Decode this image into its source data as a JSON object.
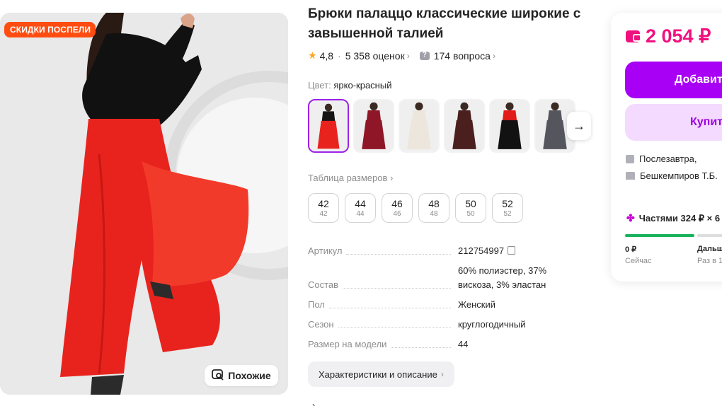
{
  "product": {
    "title": "Брюки палаццо классические широкие с завышенной талией",
    "rating": "4,8",
    "reviews": "5 358 оценок",
    "questions": "174 вопроса",
    "sale_badge": "СКИДКИ ПОСПЕЛИ",
    "similar_label": "Похожие"
  },
  "color": {
    "label": "Цвет:",
    "value": "ярко-красный",
    "swatches": [
      {
        "name": "ярко-красный",
        "main": "#e8231e",
        "top": "#151515"
      },
      {
        "name": "бордовый",
        "main": "#8f1626",
        "top": "#8f1626"
      },
      {
        "name": "молочный",
        "main": "#ece6dd",
        "top": "#ece6dd"
      },
      {
        "name": "шоколадный",
        "main": "#4a1f1d",
        "top": "#4a1f1d"
      },
      {
        "name": "черный",
        "main": "#121212",
        "top": "#e21a1a"
      },
      {
        "name": "серый",
        "main": "#55555d",
        "top": "#55555d"
      }
    ]
  },
  "sizes": {
    "table_link": "Таблица размеров",
    "items": [
      {
        "ru": "42",
        "intl": "42"
      },
      {
        "ru": "44",
        "intl": "44"
      },
      {
        "ru": "46",
        "intl": "46"
      },
      {
        "ru": "48",
        "intl": "48"
      },
      {
        "ru": "50",
        "intl": "50"
      },
      {
        "ru": "52",
        "intl": "52"
      }
    ]
  },
  "specs": [
    {
      "key": "Артикул",
      "value": "212754997"
    },
    {
      "key": "Состав",
      "value": "60% полиэстер, 37% вискоза, 3% эластан"
    },
    {
      "key": "Пол",
      "value": "Женский"
    },
    {
      "key": "Сезон",
      "value": "круглогодичный"
    },
    {
      "key": "Размер на модели",
      "value": "44"
    }
  ],
  "chars_button": "Характеристики и описание",
  "buy": {
    "price": "2 054 ₽",
    "add_label": "Добавит",
    "buy_label": "Купит",
    "delivery": "Послезавтра,",
    "seller": "Бешкемпиров Т.Б.",
    "parts": "Частями 324 ₽ × 6",
    "pay_now_amount": "0 ₽",
    "pay_now_label": "Сейчас",
    "pay_later_amount": "Дальш",
    "pay_later_label": "Раз в 1"
  },
  "colors": {
    "accent": "#a800f5",
    "price": "#f1117e",
    "sale": "#ff4d12",
    "pants": "#e8231e"
  }
}
